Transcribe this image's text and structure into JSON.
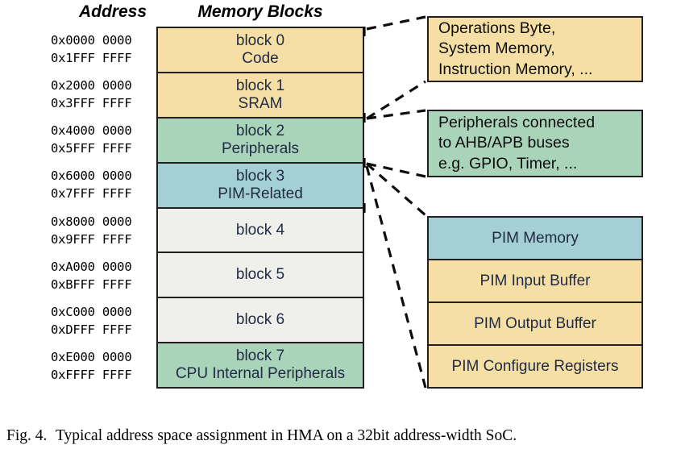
{
  "figure": {
    "headers": {
      "address": "Address",
      "memory_blocks": "Memory Blocks"
    },
    "caption": {
      "label": "Fig. 4.",
      "text": "Typical address space assignment in HMA on a 32bit address-width SoC."
    }
  },
  "colors": {
    "tan": "#f5dfa4",
    "green": "#a9d4ba",
    "teal": "#a4d0d5",
    "gray": "#efefeb",
    "stroke": "#231f20",
    "block_text": "#1f2a44",
    "callout_text": "#0d0d0d"
  },
  "memory_map": {
    "blocks": [
      {
        "name": "block 0",
        "desc": "Code",
        "addr_start": "0x0000 0000",
        "addr_end": "0x1FFF FFFF",
        "fill": "#f5dfa4"
      },
      {
        "name": "block 1",
        "desc": "SRAM",
        "addr_start": "0x2000 0000",
        "addr_end": "0x3FFF FFFF",
        "fill": "#f5dfa4"
      },
      {
        "name": "block 2",
        "desc": "Peripherals",
        "addr_start": "0x4000 0000",
        "addr_end": "0x5FFF FFFF",
        "fill": "#a9d4ba"
      },
      {
        "name": "block 3",
        "desc": "PIM-Related",
        "addr_start": "0x6000 0000",
        "addr_end": "0x7FFF FFFF",
        "fill": "#a4d0d5"
      },
      {
        "name": "block 4",
        "desc": "",
        "addr_start": "0x8000 0000",
        "addr_end": "0x9FFF FFFF",
        "fill": "#efefeb"
      },
      {
        "name": "block 5",
        "desc": "",
        "addr_start": "0xA000 0000",
        "addr_end": "0xBFFF FFFF",
        "fill": "#efefeb"
      },
      {
        "name": "block 6",
        "desc": "",
        "addr_start": "0xC000 0000",
        "addr_end": "0xDFFF FFFF",
        "fill": "#efefeb"
      },
      {
        "name": "block 7",
        "desc": "CPU Internal Peripherals",
        "addr_start": "0xE000 0000",
        "addr_end": "0xFFFF FFFF",
        "fill": "#a9d4ba"
      }
    ]
  },
  "callouts": [
    {
      "id": "code",
      "fill": "#f5dfa4",
      "lines": [
        "Operations Byte,",
        "System Memory,",
        "Instruction Memory, ..."
      ]
    },
    {
      "id": "peripherals",
      "fill": "#a9d4ba",
      "lines": [
        "Peripherals connected",
        "to AHB/APB buses",
        "e.g. GPIO, Timer, ..."
      ]
    }
  ],
  "pim_stack": {
    "rows": [
      {
        "label": "PIM Memory",
        "fill": "#a4d0d5"
      },
      {
        "label": "PIM Input Buffer",
        "fill": "#f5dfa4"
      },
      {
        "label": "PIM Output Buffer",
        "fill": "#f5dfa4"
      },
      {
        "label": "PIM Configure Registers",
        "fill": "#f5dfa4"
      }
    ]
  }
}
